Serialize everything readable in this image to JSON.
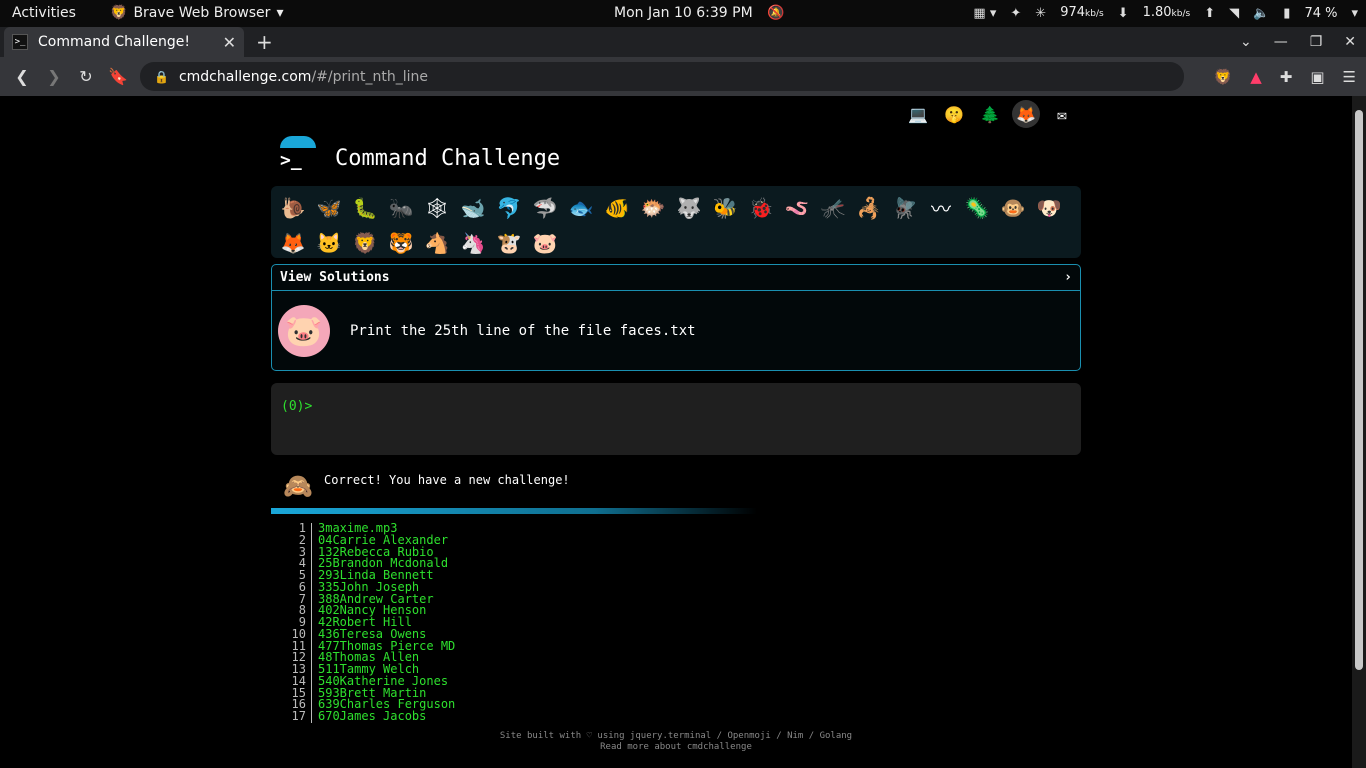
{
  "system_bar": {
    "activities": "Activities",
    "app_name": "Brave Web Browser",
    "clock": "Mon Jan 10  6:39 PM",
    "net_down": "974",
    "net_down_unit": "kb/s",
    "net_up": "1.80",
    "net_up_unit": "kb/s",
    "battery": "74 %"
  },
  "browser": {
    "tab_title": "Command Challenge!",
    "url_host": "cmdchallenge.com",
    "url_path": "/#/print_nth_line"
  },
  "site": {
    "title": "Command Challenge",
    "view_solutions": "View Solutions",
    "chevron": "›",
    "challenge_text": "Print the 25th line of the file faces.txt",
    "prompt": "(0)>",
    "status_message": "Correct! You have a new challenge!",
    "footer_line1": "Site built with ♡ using jquery.terminal / Openmoji / Nim / Golang",
    "footer_line2": "Read more about cmdchallenge"
  },
  "animals": [
    "snail-icon",
    "butterfly-icon",
    "caterpillar-icon",
    "ant-icon",
    "spider-web-icon",
    "whale-icon",
    "dolphin-icon",
    "shark-icon",
    "fish-icon",
    "tropical-fish-icon",
    "blowfish-icon",
    "wolf-icon",
    "bee-icon",
    "ladybug-icon",
    "worm-icon",
    "mosquito-icon",
    "scorpion-icon",
    "fly-icon",
    "earthworm-icon",
    "microbe-icon",
    "monkey-icon",
    "dog-icon",
    "fox-icon",
    "cat-icon",
    "lion-icon",
    "tiger-icon",
    "horse-icon",
    "unicorn-icon",
    "cow-icon",
    "pig-icon"
  ],
  "output_lines": [
    {
      "n": "1",
      "text": "3maxime.mp3"
    },
    {
      "n": "2",
      "text": "04Carrie Alexander"
    },
    {
      "n": "3",
      "text": "132Rebecca Rubio"
    },
    {
      "n": "4",
      "text": "25Brandon Mcdonald"
    },
    {
      "n": "5",
      "text": "293Linda Bennett"
    },
    {
      "n": "6",
      "text": "335John Joseph"
    },
    {
      "n": "7",
      "text": "388Andrew Carter"
    },
    {
      "n": "8",
      "text": "402Nancy Henson"
    },
    {
      "n": "9",
      "text": "42Robert Hill"
    },
    {
      "n": "10",
      "text": "436Teresa Owens"
    },
    {
      "n": "11",
      "text": "477Thomas Pierce MD"
    },
    {
      "n": "12",
      "text": "48Thomas Allen"
    },
    {
      "n": "13",
      "text": "511Tammy Welch"
    },
    {
      "n": "14",
      "text": "540Katherine Jones"
    },
    {
      "n": "15",
      "text": "593Brett Martin"
    },
    {
      "n": "16",
      "text": "639Charles Ferguson"
    },
    {
      "n": "17",
      "text": "670James Jacobs"
    }
  ]
}
